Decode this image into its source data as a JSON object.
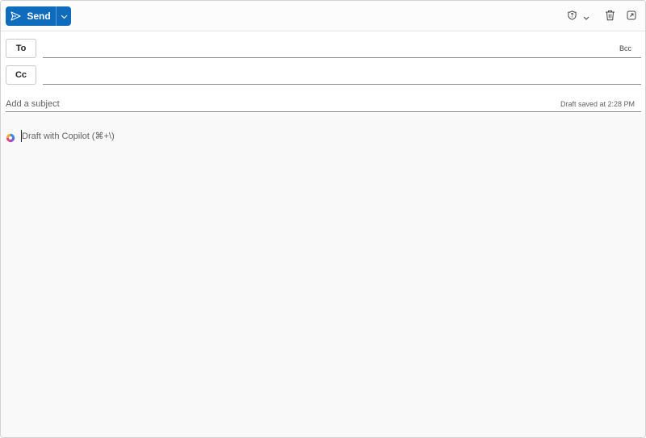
{
  "toolbar": {
    "send_label": "Send",
    "send_dropdown_icon": "chevron-down-icon",
    "sensitivity_icon": "shield-icon",
    "discard_icon": "trash-icon",
    "popout_icon": "open-in-new-window-icon",
    "accent_color": "#0f6cbd"
  },
  "recipients": {
    "to_label": "To",
    "to_value": "",
    "cc_label": "Cc",
    "cc_value": "",
    "bcc_label": "Bcc"
  },
  "subject": {
    "placeholder": "Add a subject",
    "value": "",
    "draft_status": "Draft saved at 2:28 PM"
  },
  "body": {
    "copilot_icon": "copilot-icon",
    "copilot_hint": "Draft with Copilot (⌘+\\)"
  }
}
